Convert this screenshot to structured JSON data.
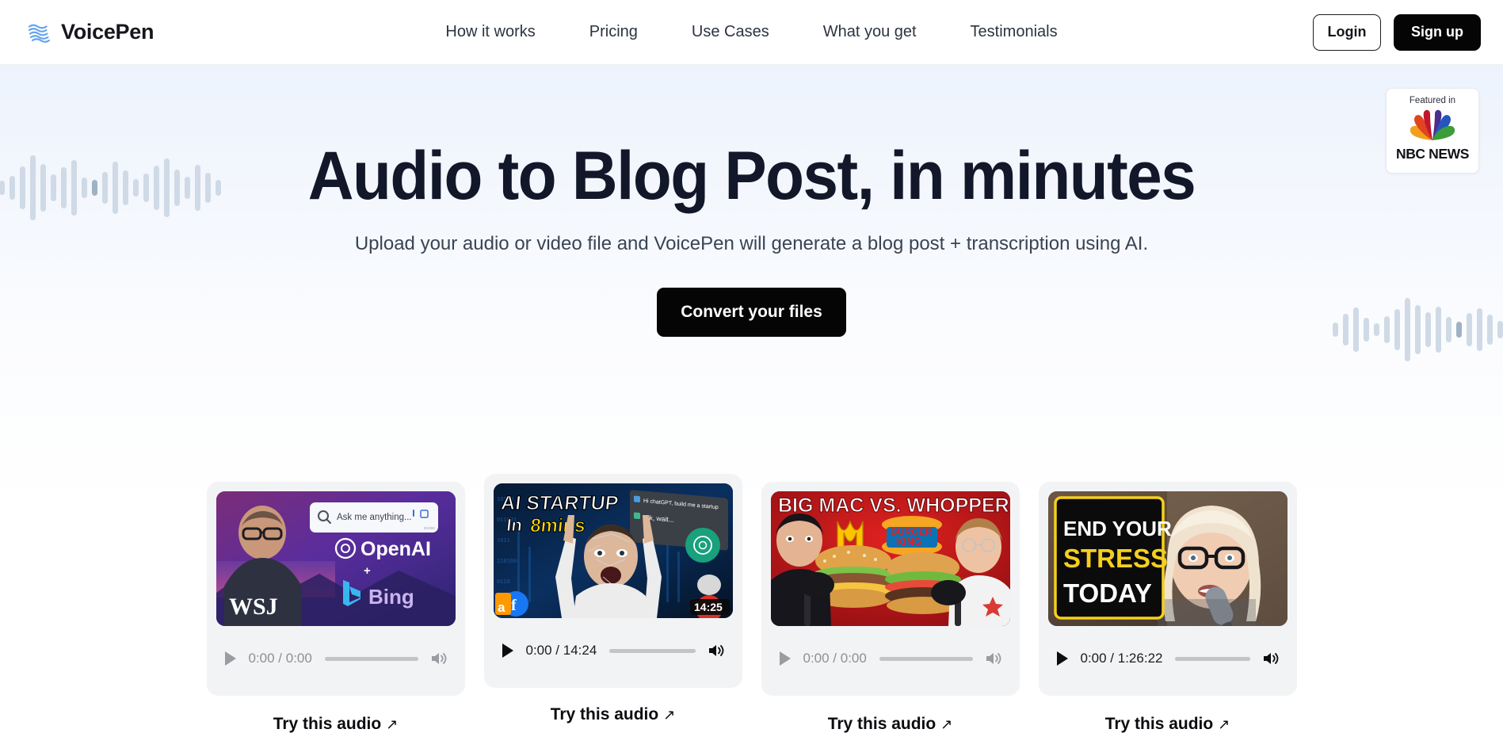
{
  "brand": {
    "name": "VoicePen",
    "logo_icon": "soundwave-logo-icon",
    "accent": "#63a4ef"
  },
  "nav": {
    "items": [
      {
        "label": "How it works"
      },
      {
        "label": "Pricing"
      },
      {
        "label": "Use Cases"
      },
      {
        "label": "What you get"
      },
      {
        "label": "Testimonials"
      }
    ],
    "login_label": "Login",
    "signup_label": "Sign up"
  },
  "hero": {
    "title": "Audio to Blog Post, in minutes",
    "subtitle": "Upload your audio or video file and VoicePen will generate a blog post + transcription using AI.",
    "cta_label": "Convert your files",
    "title_color": "#121829"
  },
  "featured_badge": {
    "label": "Featured in",
    "brand": "NBC NEWS",
    "logo_icon": "nbc-peacock-icon",
    "feather_colors": [
      "#f0a01e",
      "#e0451f",
      "#c0172e",
      "#4b2d8e",
      "#2456c0",
      "#3a9d3a"
    ]
  },
  "decor": {
    "left_waveform_icon": "audio-waveform-icon",
    "right_waveform_icon": "audio-waveform-icon",
    "wave_color": "#cfdae6",
    "wave_accent_color": "#9fb2c4"
  },
  "cards": [
    {
      "id": "wsj-openai-bing",
      "thumbnail": {
        "alt": "WSJ interview with OpenAI + Bing graphics",
        "overlay_texts": [
          "Ask me anything...",
          "OpenAI",
          "+",
          "Bing",
          "WSJ"
        ],
        "duration_badge": ""
      },
      "player": {
        "state": "muted",
        "play_icon": "play-icon",
        "volume_icon": "volume-icon",
        "current_time": "0:00",
        "duration": "0:00",
        "time_display": "0:00 / 0:00",
        "progress": 0
      },
      "link_label": "Try this audio",
      "link_arrow": "↗"
    },
    {
      "id": "ai-startup-8mins",
      "thumbnail": {
        "alt": "AI STARTUP In 8mins ChatGPT thumbnail",
        "overlay_texts": [
          "AI STARTUP",
          "In",
          "8mins",
          "Hi chatGPT, build me a startup",
          "Ok, wait..."
        ],
        "duration_badge": "14:25"
      },
      "player": {
        "state": "active",
        "play_icon": "play-icon",
        "volume_icon": "volume-icon",
        "current_time": "0:00",
        "duration": "14:24",
        "time_display": "0:00 / 14:24",
        "progress": 0
      },
      "link_label": "Try this audio",
      "link_arrow": "↗"
    },
    {
      "id": "big-mac-vs-whopper",
      "thumbnail": {
        "alt": "BIG MAC VS. WHOPPER podcast thumbnail",
        "overlay_texts": [
          "BIG MAC VS. WHOPPER",
          "BURGER KING"
        ],
        "duration_badge": ""
      },
      "player": {
        "state": "muted",
        "play_icon": "play-icon",
        "volume_icon": "volume-icon",
        "current_time": "0:00",
        "duration": "0:00",
        "time_display": "0:00 / 0:00",
        "progress": 0
      },
      "link_label": "Try this audio",
      "link_arrow": "↗"
    },
    {
      "id": "end-your-stress-today",
      "thumbnail": {
        "alt": "END YOUR STRESS TODAY talk thumbnail",
        "overlay_texts": [
          "END YOUR",
          "STRESS",
          "TODAY"
        ],
        "duration_badge": ""
      },
      "player": {
        "state": "active",
        "play_icon": "play-icon",
        "volume_icon": "volume-icon",
        "current_time": "0:00",
        "duration": "1:26:22",
        "time_display": "0:00 / 1:26:22",
        "progress": 0
      },
      "link_label": "Try this audio",
      "link_arrow": "↗"
    }
  ]
}
